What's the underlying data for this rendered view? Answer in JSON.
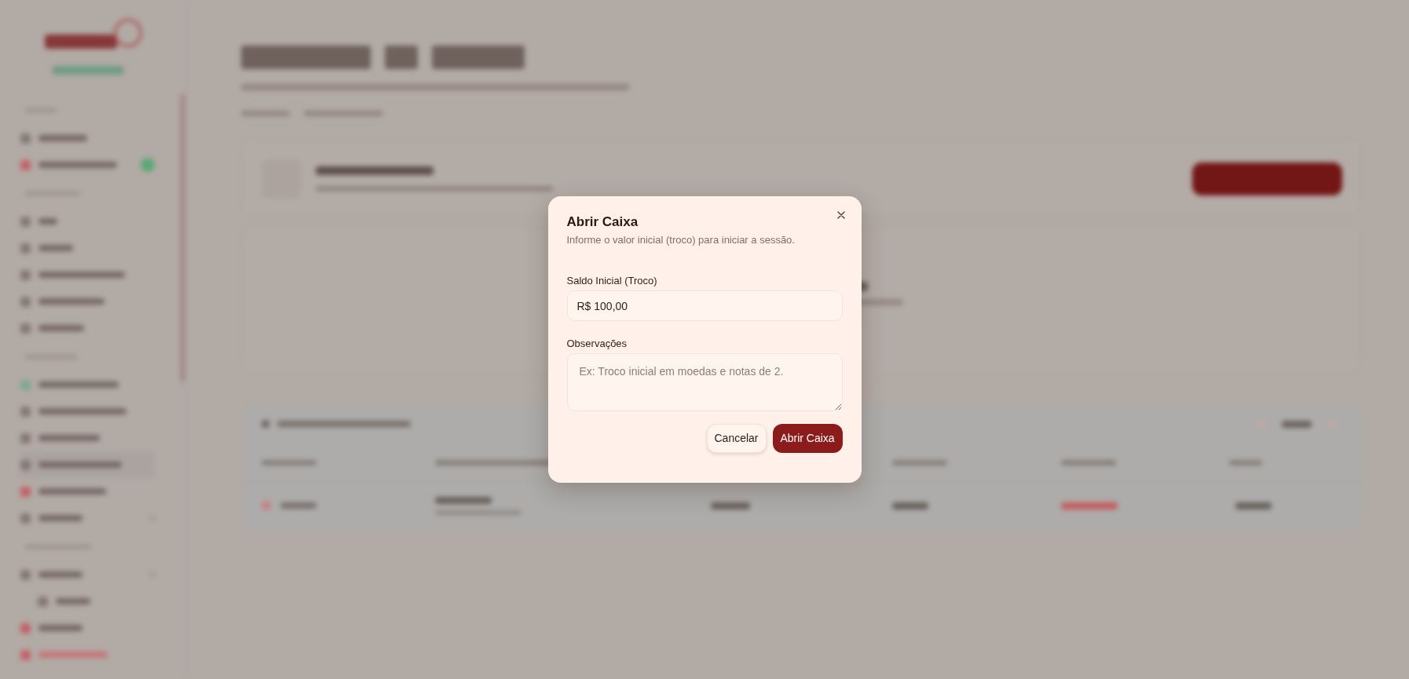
{
  "dialog": {
    "title": "Abrir Caixa",
    "description": "Informe o valor inicial (troco) para iniciar a sessão.",
    "fields": [
      {
        "kind": "input",
        "label": "Saldo Inicial (Troco)",
        "value": "R$ 100,00"
      },
      {
        "kind": "textarea",
        "label": "Observações",
        "placeholder": "Ex: Troco inicial em moedas e notas de 2."
      }
    ],
    "buttons": [
      {
        "kind": "secondary",
        "label": "Cancelar"
      },
      {
        "kind": "primary",
        "label": "Abrir Caixa"
      }
    ]
  }
}
